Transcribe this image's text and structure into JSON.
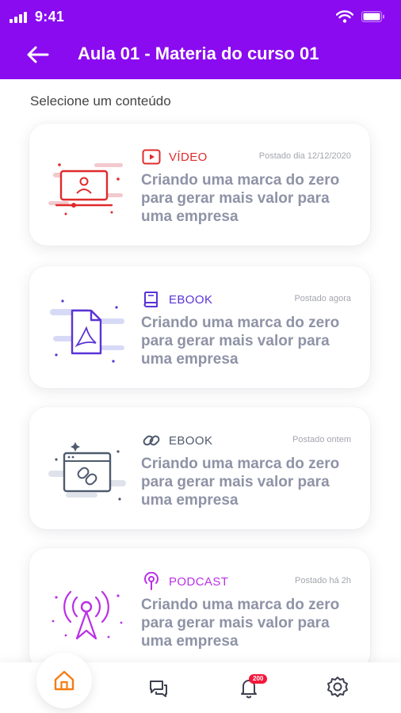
{
  "status_bar": {
    "time": "9:41"
  },
  "header": {
    "title": "Aula 01 - Materia do curso 01"
  },
  "subtitle": "Selecione um conteúdo",
  "colors": {
    "header_bg": "#8a0bf0",
    "video": "#e02b2b",
    "ebook": "#5a33d6",
    "link": "#4f5a6e",
    "podcast": "#b930e6",
    "home_active": "#f57c14",
    "badge": "#f4173c"
  },
  "cards": [
    {
      "type": "VÍDEO",
      "icon": "play-video-icon",
      "date": "Postado dia 12/12/2020",
      "text": "Criando uma marca do zero para gerar mais valor para uma empresa"
    },
    {
      "type": "EBOOK",
      "icon": "book-icon",
      "date": "Postado agora",
      "text": "Criando uma marca do zero para gerar mais valor para uma empresa"
    },
    {
      "type": "EBOOK",
      "icon": "link-icon",
      "date": "Postado ontem",
      "text": "Criando uma marca do zero para gerar mais valor para uma empresa"
    },
    {
      "type": "PODCAST",
      "icon": "podcast-icon",
      "date": "Postado há 2h",
      "text": "Criando uma marca do zero para gerar mais valor para uma empresa"
    }
  ],
  "bottom_nav": {
    "items": [
      "home-icon",
      "chat-icon",
      "bell-icon",
      "gear-icon"
    ],
    "notifications_badge": "200"
  }
}
